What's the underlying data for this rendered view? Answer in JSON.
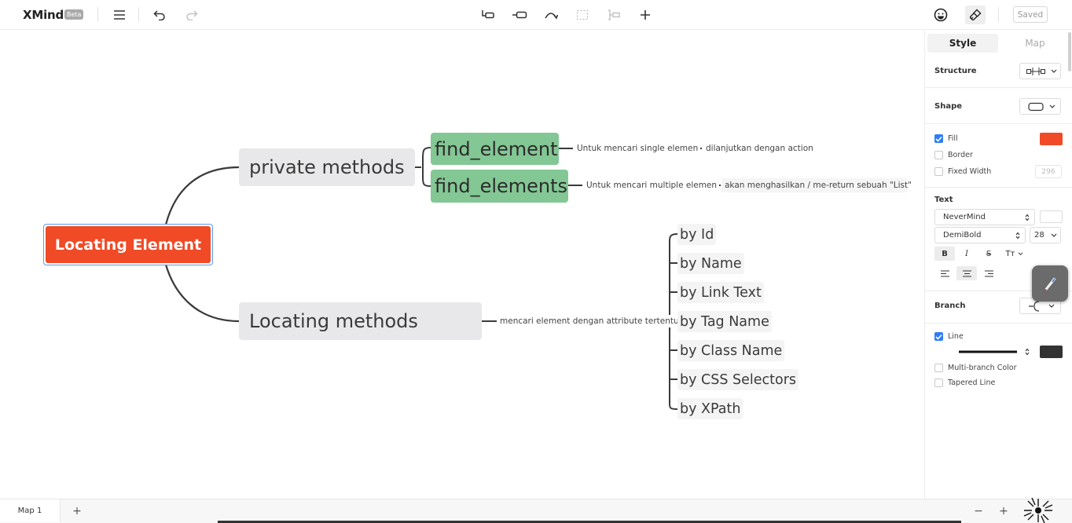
{
  "app": {
    "name": "XMind",
    "badge": "Beta",
    "saved_label": "Saved"
  },
  "toolbar": {
    "icons": [
      "menu-icon",
      "undo-icon",
      "redo-icon",
      "topic-icon",
      "subtopic-icon",
      "relationship-icon",
      "boundary-icon",
      "summary-icon",
      "add-icon",
      "emoji-icon",
      "format-brush-icon"
    ]
  },
  "map": {
    "central": "Locating Element",
    "branches": [
      {
        "title": "private methods",
        "children": [
          {
            "title": "find_element",
            "notes": [
              "Untuk mencari single elemen",
              "dilanjutkan dengan action"
            ]
          },
          {
            "title": "find_elements",
            "notes": [
              "Untuk mencari multiple elemen",
              "akan menghasilkan / me-return sebuah \"List\""
            ]
          }
        ]
      },
      {
        "title": "Locating methods",
        "note": "mencari element dengan attribute tertentu",
        "children": [
          "by Id",
          "by Name",
          "by Link Text",
          "by Tag Name",
          "by Class Name",
          "by CSS Selectors",
          "by XPath"
        ]
      }
    ]
  },
  "panel": {
    "tabs": [
      "Style",
      "Map"
    ],
    "active_tab": "Style",
    "structure_label": "Structure",
    "shape_label": "Shape",
    "fill_label": "Fill",
    "fill_checked": true,
    "fill_color": "#f04a26",
    "border_label": "Border",
    "border_checked": false,
    "fixed_width_label": "Fixed Width",
    "fixed_width_checked": false,
    "fixed_width_value": "296",
    "text_label": "Text",
    "font_family": "NeverMind",
    "font_weight": "DemiBold",
    "font_size": "28",
    "text_color": "#ffffff",
    "format_buttons": [
      "B",
      "I",
      "S",
      "Tт"
    ],
    "branch_label": "Branch",
    "line_label": "Line",
    "line_checked": true,
    "line_color": "#333333",
    "multi_branch_label": "Multi-branch Color",
    "multi_branch_checked": false,
    "tapered_label": "Tapered Line",
    "tapered_checked": false
  },
  "bottom": {
    "sheet_tab": "Map 1",
    "add_sheet": "+",
    "zoom_out": "−",
    "zoom_in": "+"
  },
  "colors": {
    "central": "#f04a26",
    "main_topic_bg": "#e8e8ea",
    "subtopic_green": "#83c794",
    "accent_blue": "#2f7df6"
  }
}
